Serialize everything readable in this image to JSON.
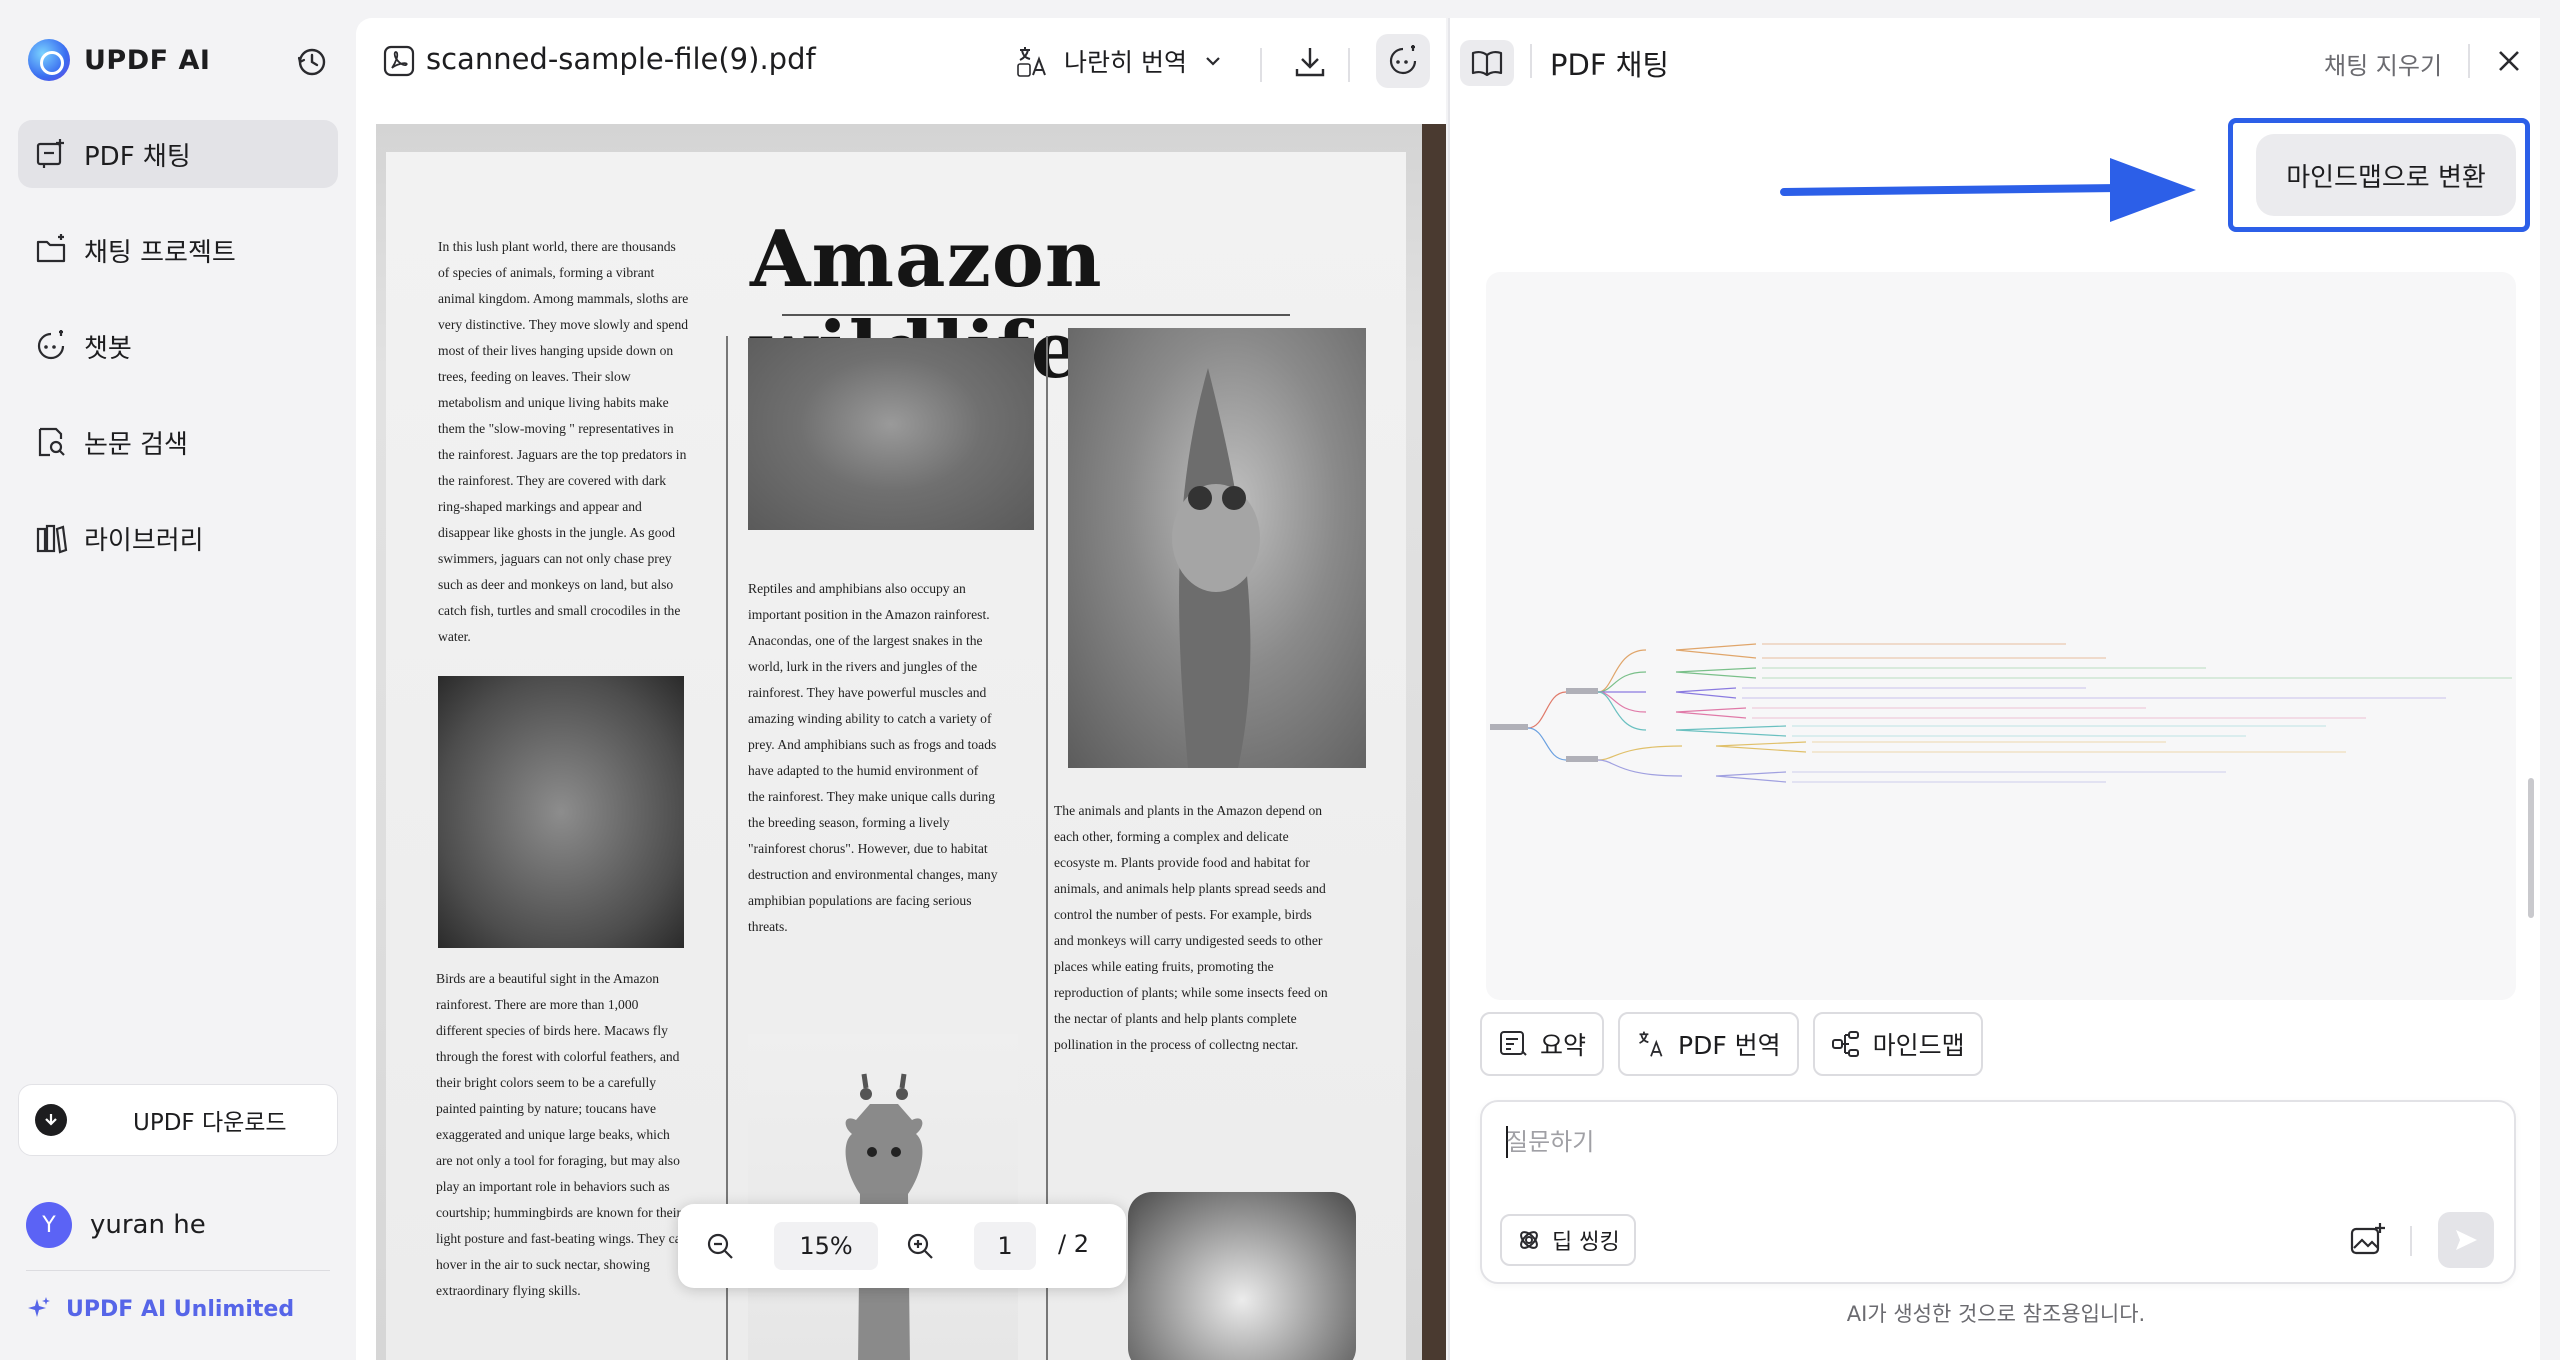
{
  "app": {
    "name": "UPDF AI"
  },
  "sidebar": {
    "items": [
      {
        "label": "PDF 채팅",
        "icon": "chat-pdf-icon",
        "active": true
      },
      {
        "label": "채팅 프로젝트",
        "icon": "folder-chat-icon",
        "active": false
      },
      {
        "label": "챗봇",
        "icon": "chatbot-icon",
        "active": false
      },
      {
        "label": "논문 검색",
        "icon": "paper-search-icon",
        "active": false
      },
      {
        "label": "라이브러리",
        "icon": "library-icon",
        "active": false
      }
    ],
    "download_label": "UPDF 다운로드",
    "user": {
      "initial": "Y",
      "name": "yuran he"
    },
    "plan_label": "UPDF AI Unlimited"
  },
  "viewer": {
    "file_name": "scanned-sample-file(9).pdf",
    "translate_mode": "나란히 번역",
    "zoom": "15%",
    "page_current": "1",
    "page_total": "/ 2",
    "page": {
      "title": "Amazon wildlife",
      "col1_top": "In this lush plant world, there are thousands of species of animals, forming a vibrant animal kingdom. Among mammals, sloths are very distinctive. They move slowly and spend most of their lives hanging upside down on trees, feeding on leaves. Their slow metabolism and unique living habits make them the \"slow-moving \" representatives in the rainforest. Jaguars are the top predators in the rainforest. They are covered with dark ring-shaped markings and appear and disappear like ghosts in the jungle. As good swimmers, jaguars can not only chase prey such as deer and monkeys on land, but also catch fish, turtles and small crocodiles in the water.",
      "col1_bottom": "Birds are a beautiful sight in the Amazon rainforest. There are more than 1,000 different species of birds here. Macaws fly through the forest with colorful feathers, and their bright colors seem to be a carefully painted painting by nature; toucans have exaggerated and unique large beaks, which are not only a tool for foraging, but may also play an important role in behaviors such as courtship; hummingbirds are known for their light posture and fast-beating wings. They can hover in the air to suck nectar, showing extraordinary flying skills.",
      "col2": "Reptiles and amphibians also occupy an important position in the Amazon rainforest. Anacondas, one of the largest snakes in the world, lurk in the rivers and jungles of the rainforest. They have powerful muscles and amazing winding ability to catch a variety of prey. And amphibians such as frogs and toads have adapted to the humid environment of the rainforest. They make unique calls during the breeding season, forming a lively \"rainforest chorus\". However, due to habitat destruction and environmental changes, many amphibian populations are facing serious threats.",
      "col3": "The animals and plants in the Amazon depend on each other, forming a complex and delicate ecosyste m. Plants provide food and habitat for animals, and animals help plants spread seeds and control the number of pests. For example, birds and monkeys will carry undigested seeds to other places while eating fruits, promoting the reproduction of plants; while some insects feed on the nectar of plants and help plants complete pollination in the process of collectng nectar."
    }
  },
  "chat": {
    "title": "PDF 채팅",
    "clear_label": "채팅 지우기",
    "convert_button": "마인드맵으로 변환",
    "chips": [
      {
        "label": "요약",
        "icon": "summary-icon"
      },
      {
        "label": "PDF 번역",
        "icon": "translate-icon"
      },
      {
        "label": "마인드맵",
        "icon": "mindmap-icon"
      }
    ],
    "input_placeholder": "질문하기",
    "deep_thinking_label": "딥 씽킹",
    "disclaimer": "AI가 생성한 것으로 참조용입니다.",
    "accent_color": "#2c5fe8"
  }
}
